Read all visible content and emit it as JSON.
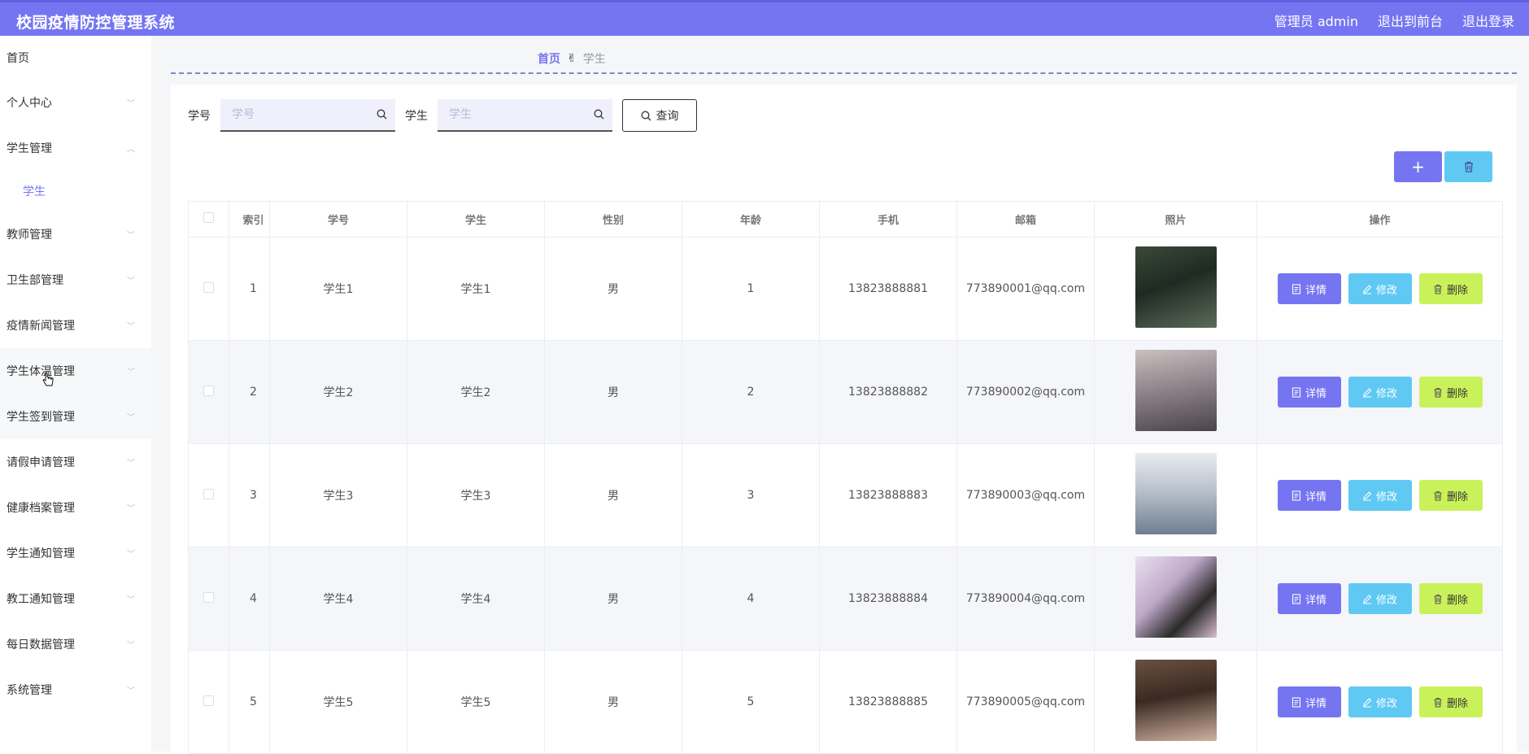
{
  "header": {
    "title": "校园疫情防控管理系统",
    "admin_label": "管理员 admin",
    "to_front": "退出到前台",
    "logout": "退出登录"
  },
  "sidebar": {
    "items": [
      {
        "label": "首页"
      },
      {
        "label": "个人中心"
      },
      {
        "label": "学生管理"
      },
      {
        "label": "学生"
      },
      {
        "label": "教师管理"
      },
      {
        "label": "卫生部管理"
      },
      {
        "label": "疫情新闻管理"
      },
      {
        "label": "学生体温管理"
      },
      {
        "label": "学生签到管理"
      },
      {
        "label": "请假申请管理"
      },
      {
        "label": "健康档案管理"
      },
      {
        "label": "学生通知管理"
      },
      {
        "label": "教工通知管理"
      },
      {
        "label": "每日数据管理"
      },
      {
        "label": "系统管理"
      }
    ]
  },
  "breadcrumb": {
    "home": "首页",
    "current": "学生"
  },
  "search": {
    "id_label": "学号",
    "id_placeholder": "学号",
    "name_label": "学生",
    "name_placeholder": "学生",
    "query_label": "查询"
  },
  "table": {
    "headers": [
      "索引",
      "学号",
      "学生",
      "性别",
      "年龄",
      "手机",
      "邮箱",
      "照片",
      "操作"
    ],
    "rows": [
      {
        "index": "1",
        "sid": "学生1",
        "name": "学生1",
        "gender": "男",
        "age": "1",
        "phone": "13823888881",
        "email": "773890001@qq.com"
      },
      {
        "index": "2",
        "sid": "学生2",
        "name": "学生2",
        "gender": "男",
        "age": "2",
        "phone": "13823888882",
        "email": "773890002@qq.com"
      },
      {
        "index": "3",
        "sid": "学生3",
        "name": "学生3",
        "gender": "男",
        "age": "3",
        "phone": "13823888883",
        "email": "773890003@qq.com"
      },
      {
        "index": "4",
        "sid": "学生4",
        "name": "学生4",
        "gender": "男",
        "age": "4",
        "phone": "13823888884",
        "email": "773890004@qq.com"
      },
      {
        "index": "5",
        "sid": "学生5",
        "name": "学生5",
        "gender": "男",
        "age": "5",
        "phone": "13823888885",
        "email": "773890005@qq.com"
      }
    ],
    "actions": {
      "detail": "详情",
      "edit": "修改",
      "delete": "删除"
    }
  },
  "colors": {
    "accent": "#7575f2",
    "info": "#5fc9f3",
    "lime": "#c9f25a"
  }
}
